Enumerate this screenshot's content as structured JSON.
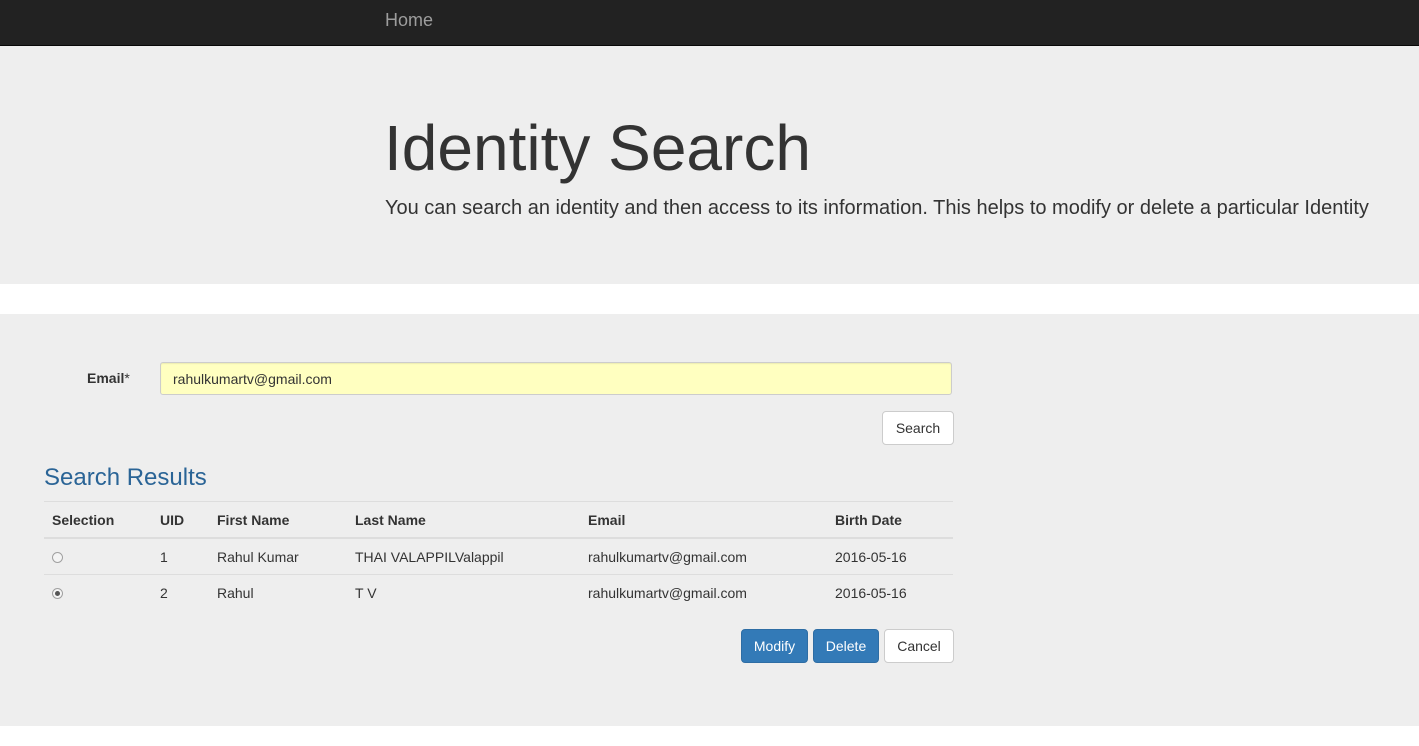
{
  "navbar": {
    "home_label": "Home"
  },
  "header": {
    "title": "Identity Search",
    "subtitle": "You can search an identity and then access to its information. This helps to modify or delete a particular Identity"
  },
  "search_form": {
    "email_label": "Email",
    "required_marker": "*",
    "email_value": "rahulkumartv@gmail.com",
    "search_button": "Search"
  },
  "results": {
    "title": "Search Results",
    "columns": [
      "Selection",
      "UID",
      "First Name",
      "Last Name",
      "Email",
      "Birth Date"
    ],
    "rows": [
      {
        "selected": false,
        "uid": "1",
        "first_name": "Rahul Kumar",
        "last_name": "THAI VALAPPILValappil",
        "email": "rahulkumartv@gmail.com",
        "birth_date": "2016-05-16"
      },
      {
        "selected": true,
        "uid": "2",
        "first_name": "Rahul",
        "last_name": "T V",
        "email": "rahulkumartv@gmail.com",
        "birth_date": "2016-05-16"
      }
    ]
  },
  "actions": {
    "modify": "Modify",
    "delete": "Delete",
    "cancel": "Cancel"
  },
  "colors": {
    "navbar_bg": "#222222",
    "panel_bg": "#eeeeee",
    "primary": "#337ab7",
    "heading_blue": "#2a6496",
    "input_autofill": "#ffffc0"
  }
}
